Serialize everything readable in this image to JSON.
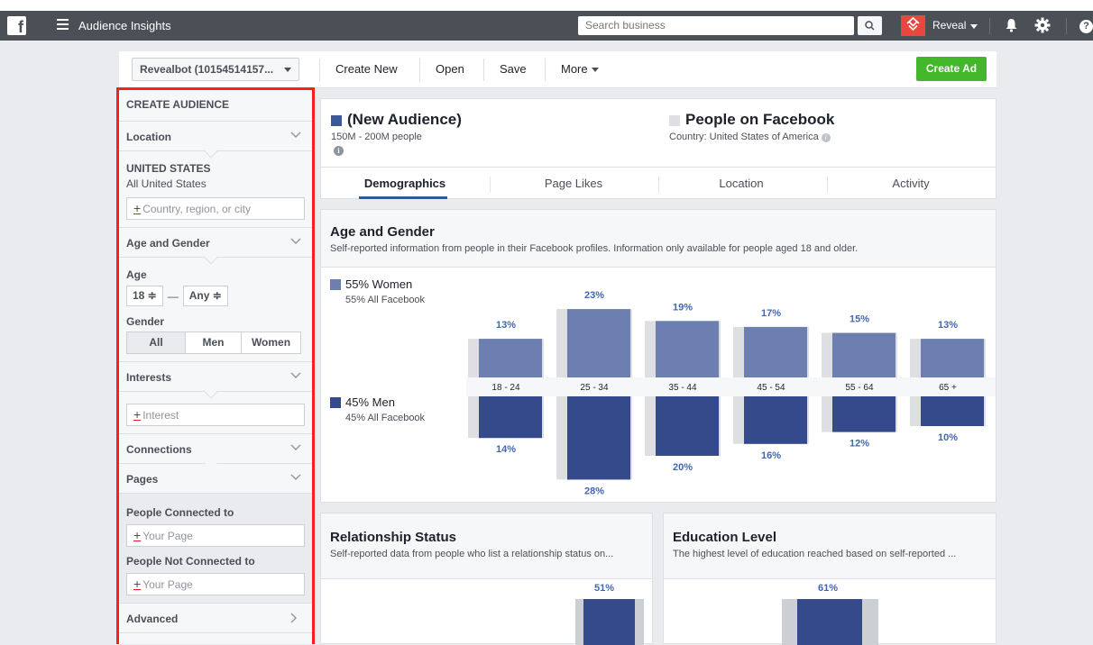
{
  "topbar": {
    "app_title": "Audience Insights",
    "search_placeholder": "Search business",
    "account_name": "Reveal",
    "icons": [
      "facebook-logo",
      "menu-icon",
      "search-icon",
      "bell-icon",
      "gear-icon",
      "help-icon"
    ]
  },
  "toolbar": {
    "account_select": "Revealbot (10154514157...",
    "create_new": "Create New",
    "open": "Open",
    "save": "Save",
    "more": "More",
    "create_ad": "Create Ad"
  },
  "sidebar": {
    "header": "CREATE AUDIENCE",
    "location": {
      "label": "Location",
      "country": "UNITED STATES",
      "scope": "All United States",
      "placeholder": "Country, region, or city"
    },
    "age_gender": {
      "label": "Age and Gender",
      "age_label": "Age",
      "age_min": "18 ≑",
      "dash": "—",
      "age_max": "Any ≑",
      "gender_label": "Gender",
      "genders": [
        "All",
        "Men",
        "Women"
      ],
      "selected_gender": "All"
    },
    "interests": {
      "label": "Interests",
      "placeholder": "Interest"
    },
    "connections": {
      "label": "Connections"
    },
    "pages": {
      "label": "Pages",
      "connected_label": "People Connected to",
      "connected_placeholder": "Your Page",
      "not_connected_label": "People Not Connected to",
      "not_connected_placeholder": "Your Page"
    },
    "advanced": {
      "label": "Advanced"
    }
  },
  "audience": {
    "name": "(New Audience)",
    "size": "150M - 200M people",
    "compare_name": "People on Facebook",
    "compare_sub": "Country: United States of America",
    "color": "#3b5998",
    "compare_color": "#dddfe2"
  },
  "tabs": [
    "Demographics",
    "Page Likes",
    "Location",
    "Activity"
  ],
  "active_tab": "Demographics",
  "age_gender_panel": {
    "title": "Age and Gender",
    "description": "Self-reported information from people in their Facebook profiles. Information only available for people aged 18 and older.",
    "women_label": "55% Women",
    "women_sub": "55% All Facebook",
    "men_label": "45% Men",
    "men_sub": "45% All Facebook",
    "women_color": "#6d7fb0",
    "men_color": "#344a8a"
  },
  "chart_data": {
    "type": "bar",
    "categories": [
      "18 - 24",
      "25 - 34",
      "35 - 44",
      "45 - 54",
      "55 - 64",
      "65 +"
    ],
    "series": [
      {
        "name": "55% Women",
        "values": [
          13,
          23,
          19,
          17,
          15,
          13
        ],
        "labels": [
          "13%",
          "23%",
          "19%",
          "17%",
          "15%",
          "13%"
        ]
      },
      {
        "name": "45% Men",
        "values": [
          14,
          28,
          20,
          16,
          12,
          10
        ],
        "labels": [
          "14%",
          "28%",
          "20%",
          "16%",
          "12%",
          "10%"
        ]
      }
    ],
    "title": "Age and Gender",
    "ylim": [
      0,
      28
    ]
  },
  "relationship_panel": {
    "title": "Relationship Status",
    "description": "Self-reported data from people who list a relationship status on...",
    "visible_value": "51%"
  },
  "education_panel": {
    "title": "Education Level",
    "description": "The highest level of education reached based on self-reported ...",
    "visible_value": "61%"
  }
}
